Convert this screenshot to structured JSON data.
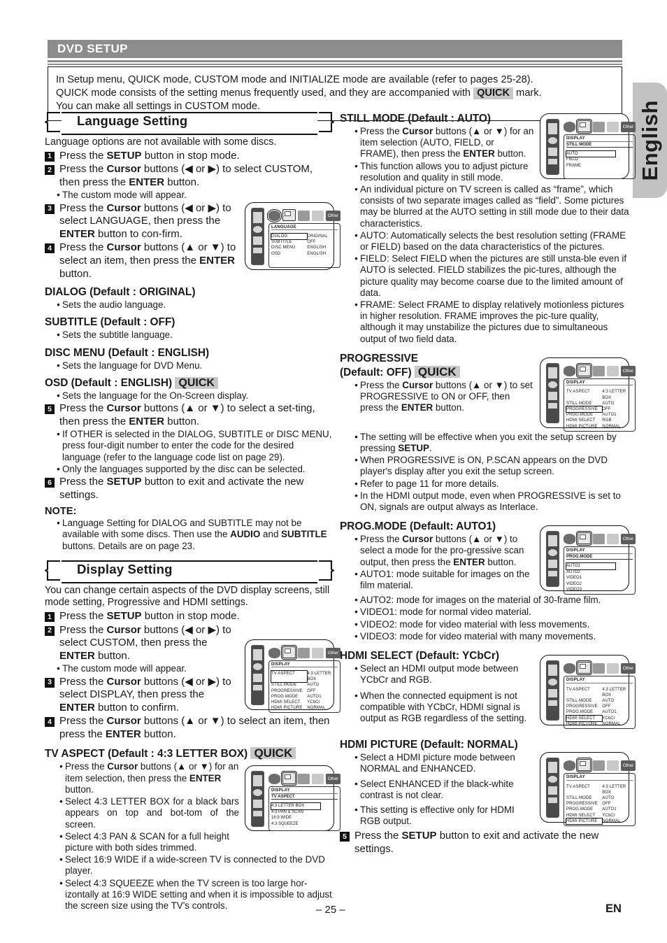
{
  "sideTab": {
    "label": "English"
  },
  "header": {
    "title": "DVD SETUP"
  },
  "intro": {
    "line1": "In Setup menu, QUICK mode, CUSTOM mode and INITIALIZE mode are available (refer to pages 25-28).",
    "line2a": "QUICK mode consists of the setting menus frequently used, and they are accompanied with",
    "quick": "QUICK",
    "line2b": "mark.",
    "line3": "You can make all settings in CUSTOM mode."
  },
  "footer": {
    "page": "– 25 –",
    "lang": "EN"
  },
  "left": {
    "section1": {
      "title": "Language Setting"
    },
    "intro": "Language options are not available with some discs.",
    "steps": [
      {
        "n": "1",
        "html": "Press the <b>SETUP</b> button in stop mode."
      },
      {
        "n": "2",
        "html": "Press the <b>Cursor</b> buttons (◀ or ▶) to select CUSTOM, then press the <b>ENTER</b> button."
      },
      {
        "n": "3",
        "html": "Press the <b>Cursor</b> buttons (◀ or ▶) to select LANGUAGE, then press the <b>ENTER</b> button to con-firm."
      },
      {
        "n": "4",
        "html": "Press the <b>Cursor</b> buttons (▲ or ▼) to select an item, then press the <b>ENTER</b> button."
      }
    ],
    "step2note": "The custom mode will appear.",
    "items": [
      {
        "head": "DIALOG (Default : ORIGINAL)",
        "bullet": "Sets the audio language."
      },
      {
        "head": "SUBTITLE (Default : OFF)",
        "bullet": "Sets the subtitle language."
      },
      {
        "head": "DISC MENU (Default : ENGLISH)",
        "bullet": "Sets the language for DVD Menu."
      }
    ],
    "osd": {
      "head": "OSD (Default : ENGLISH)",
      "quick": "QUICK",
      "bullet": "Sets the language for the On-Screen display."
    },
    "step5": {
      "n": "5",
      "html": "Press the <b>Cursor</b> buttons (▲ or ▼) to select a set-ting, then press the <b>ENTER</b> button."
    },
    "step5b1": "If OTHER is selected in the DIALOG, SUBTITLE or DISC MENU, press four-digit number to enter the code for the desired language (refer to the language code list on page 29).",
    "step5b2": "Only the languages supported by the disc can be selected.",
    "step6": {
      "n": "6",
      "html": "Press the <b>SETUP</b> button to exit and activate the new settings."
    },
    "noteHead": "NOTE:",
    "noteBody": "Language Setting for DIALOG and SUBTITLE may not be available with some discs. Then use the <b>AUDIO</b> and <b>SUBTITLE</b> buttons. Details are on page 23.",
    "section2": {
      "title": "Display Setting"
    },
    "dispIntro": "You can change certain aspects of the DVD display screens, still mode setting, Progressive and HDMI settings.",
    "dsteps": [
      {
        "n": "1",
        "html": "Press the <b>SETUP</b> button in stop mode."
      },
      {
        "n": "2",
        "html": "Press the <b>Cursor</b> buttons (◀ or ▶) to select CUSTOM, then press the <b>ENTER</b> button."
      },
      {
        "n": "3",
        "html": "Press the <b>Cursor</b> buttons (◀ or ▶) to select DISPLAY, then press the <b>ENTER</b> button to confirm."
      },
      {
        "n": "4",
        "html": "Press the <b>Cursor</b> buttons (▲ or ▼) to select an item, then press the <b>ENTER</b> button."
      }
    ],
    "dstep2note": "The custom mode will appear.",
    "tvaspect": {
      "head": "TV ASPECT (Default : 4:3 LETTER BOX)",
      "quick": "QUICK",
      "bullets": [
        "Press the <b>Cursor</b> buttons (▲ or ▼) for an item selection, then press the <b>ENTER</b> button.",
        "Select 4:3 LETTER BOX for a black bars appears on top and bot-tom of the screen.",
        "Select 4:3 PAN &amp; SCAN for a full height picture with both sides trimmed.",
        "Select 16:9 WIDE if a wide-screen TV is connected to the DVD player.",
        "Select 4:3 SQUEEZE when the TV screen is too large hor-izontally at 16:9 WIDE setting and when it is impossible to adjust the screen size using the TV's controls."
      ]
    }
  },
  "right": {
    "still": {
      "head": "STILL MODE (Default : AUTO)",
      "bullets": [
        "Press the <b>Cursor</b> buttons (▲ or ▼) for an item selection (AUTO, FIELD, or FRAME), then press the <b>ENTER</b> button.",
        "This function allows you to adjust picture resolution and quality in still mode.",
        "An individual picture on TV screen is called as “frame”, which consists of two separate images called as “field”. Some pictures may be blurred at the AUTO setting in still mode due to their data characteristics.",
        "AUTO: Automatically selects the best resolution setting (FRAME or FIELD) based on the data characteristics of the pictures.",
        "FIELD: Select FIELD when the pictures are still unsta-ble even if AUTO is selected. FIELD stabilizes the pic-tures, although the picture quality may become coarse due to the limited amount of data.",
        "FRAME: Select FRAME to display relatively motionless pictures in higher resolution. FRAME improves the pic-ture quality, although it may unstabilize the pictures due to simultaneous output of two field data."
      ]
    },
    "progressive": {
      "head1": "PROGRESSIVE",
      "head2": "(Default: OFF)",
      "quick": "QUICK",
      "bullets": [
        "Press the <b>Cursor</b> buttons (▲ or ▼) to set PROGRESSIVE to ON or OFF, then press the <b>ENTER</b> button.",
        "The setting will be effective when you exit the setup screen by pressing <b>SETUP</b>.",
        "When PROGRESSIVE is ON, P.SCAN appears on the DVD player's display after you exit the setup screen.",
        "Refer to page 11 for more details.",
        "In the HDMI output mode, even when PROGRESSIVE is set to ON, signals are output always as Interlace."
      ]
    },
    "progmode": {
      "head": "PROG.MODE (Default: AUTO1)",
      "bullets": [
        "Press the <b>Cursor</b> buttons (▲ or ▼) to select a mode for the pro-gressive scan output, then press the <b>ENTER</b> button.",
        "AUTO1: mode suitable for images on the film material.",
        "AUTO2: mode for images on the material of 30-frame film.",
        "VIDEO1: mode for normal video material.",
        "VIDEO2: mode for video material with less movements.",
        "VIDEO3: mode for video material with many movements."
      ]
    },
    "hdmiselect": {
      "head": "HDMI SELECT (Default: YCbCr)",
      "bullets": [
        "Select an HDMI output mode between YCbCr and RGB.",
        "When the connected equipment is not compatible with YCbCr, HDMI signal is output as RGB regardless of the setting."
      ]
    },
    "hdmipicture": {
      "head": "HDMI PICTURE (Default: NORMAL)",
      "bullets": [
        "Select a HDMI picture mode between NORMAL and ENHANCED.",
        "Select ENHANCED if the black-white contrast is not clear.",
        "This setting is effective only for HDMI RGB output."
      ]
    },
    "step5": {
      "n": "5",
      "html": "Press the <b>SETUP</b> button to exit and activate the new settings."
    }
  },
  "screens": {
    "iconOtherLabel": "Other",
    "language": {
      "title": "LANGUAGE",
      "rows": [
        {
          "k": "DIALOG",
          "v": "ORIGINAL",
          "hl": true
        },
        {
          "k": "SUBTITLE",
          "v": "OFF",
          "hl": false
        },
        {
          "k": "DISC MENU",
          "v": "ENGLISH",
          "hl": false
        },
        {
          "k": "OSD",
          "v": "ENGLISH",
          "hl": false
        }
      ]
    },
    "display": {
      "title": "DISPLAY",
      "rows": [
        {
          "k": "TV ASPECT",
          "v": "4:3 LETTER BOX",
          "hl": true
        },
        {
          "k": "STILL MODE",
          "v": "AUTO",
          "hl": false
        },
        {
          "k": "PROGRESSIVE",
          "v": "OFF",
          "hl": false
        },
        {
          "k": "PROG.MODE",
          "v": "AUTO1",
          "hl": false
        },
        {
          "k": "HDMI SELECT",
          "v": "YCbCr",
          "hl": false
        },
        {
          "k": "HDMI PICTURE",
          "v": "NORMAL",
          "hl": false
        }
      ]
    },
    "tvaspect": {
      "title": "DISPLAY",
      "sub": "TV ASPECT",
      "options": [
        "4:3 LETTER BOX",
        "4:3 PAN & SCAN",
        "16:9 WIDE",
        "4:3 SQUEEZE"
      ],
      "selected": "4:3 LETTER BOX"
    },
    "stillmode": {
      "title": "DISPLAY",
      "sub": "STILL MODE",
      "options": [
        "AUTO",
        "FIELD",
        "FRAME"
      ],
      "selected": "AUTO"
    },
    "progressive": {
      "title": "DISPLAY",
      "rows": [
        {
          "k": "TV ASPECT",
          "v": "4:3 LETTER BOX",
          "hl": false
        },
        {
          "k": "STILL MODE",
          "v": "AUTO",
          "hl": false
        },
        {
          "k": "PROGRESSIVE",
          "v": "OFF",
          "hl": true
        },
        {
          "k": "PROG.MODE",
          "v": "AUTO1",
          "hl": false
        },
        {
          "k": "HDMI SELECT",
          "v": "RGB",
          "hl": false
        },
        {
          "k": "HDMI PICTURE",
          "v": "NORMAL",
          "hl": false
        }
      ]
    },
    "progmode": {
      "title": "DISPLAY",
      "sub": "PROG.MODE",
      "options": [
        "AUTO1",
        "AUTO2",
        "VIDEO1",
        "VIDEO2",
        "VIDEO3"
      ],
      "selected": "AUTO1"
    },
    "hdmiselect": {
      "title": "DISPLAY",
      "rows": [
        {
          "k": "TV ASPECT",
          "v": "4:3 LETTER BOX",
          "hl": false
        },
        {
          "k": "STILL MODE",
          "v": "AUTO",
          "hl": false
        },
        {
          "k": "PROGRESSIVE",
          "v": "OFF",
          "hl": false
        },
        {
          "k": "PROG.MODE",
          "v": "AUTO1",
          "hl": false
        },
        {
          "k": "HDMI SELECT",
          "v": "YCbCr",
          "hl": true
        },
        {
          "k": "HDMI PICTURE",
          "v": "NORMAL",
          "hl": false
        }
      ]
    },
    "hdmipicture": {
      "title": "DISPLAY",
      "rows": [
        {
          "k": "TV ASPECT",
          "v": "4:3 LETTER BOX",
          "hl": false
        },
        {
          "k": "STILL MODE",
          "v": "AUTO",
          "hl": false
        },
        {
          "k": "PROGRESSIVE",
          "v": "OFF",
          "hl": false
        },
        {
          "k": "PROG.MODE",
          "v": "AUTO1",
          "hl": false
        },
        {
          "k": "HDMI SELECT",
          "v": "YCbCr",
          "hl": false
        },
        {
          "k": "HDMI PICTURE",
          "v": "NORMAL",
          "hl": true
        }
      ]
    }
  }
}
